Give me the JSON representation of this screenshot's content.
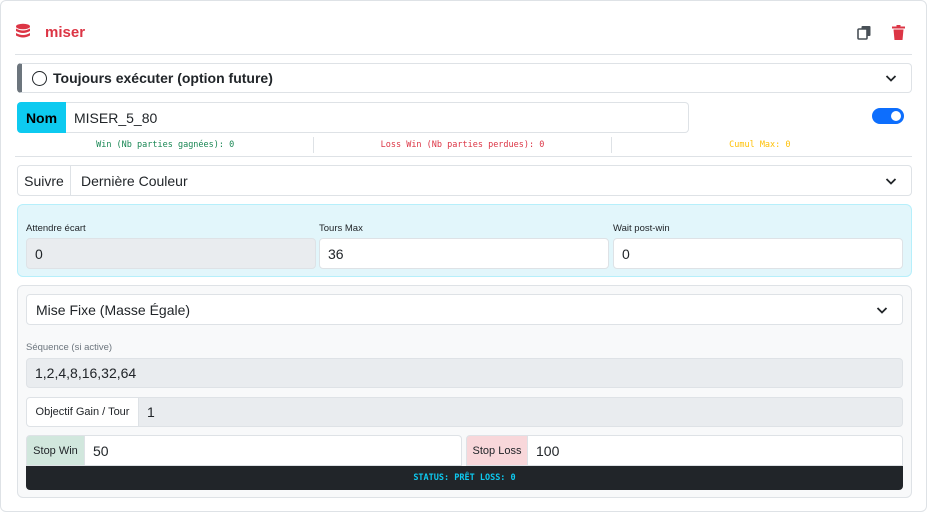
{
  "header": {
    "title": "miser",
    "title_icon": "database-icon",
    "actions": [
      "copy-icon",
      "trash-icon"
    ],
    "accent_color": "#dc3545"
  },
  "execute": {
    "label": "Toujours exécuter (option future)",
    "checked": false
  },
  "name": {
    "addon": "Nom",
    "value": "MISER_5_80",
    "enabled": true
  },
  "stats": {
    "win": "Win (Nb parties gagnées): 0",
    "loss": "Loss Win (Nb parties perdues): 0",
    "cumul": "Cumul Max: 0"
  },
  "follow": {
    "addon": "Suivre",
    "selected": "Dernière Couleur"
  },
  "params": {
    "wait_gap": {
      "label": "Attendre écart",
      "value": "0"
    },
    "max_turns": {
      "label": "Tours Max",
      "value": "36"
    },
    "wait_post_win": {
      "label": "Wait post-win",
      "value": "0"
    }
  },
  "mise": {
    "selected": "Mise Fixe (Masse Égale)",
    "sequence_label": "Séquence (si active)",
    "sequence_value": "1,2,4,8,16,32,64",
    "objective_label": "Objectif Gain / Tour",
    "objective_value": "1",
    "stop_win_label": "Stop Win",
    "stop_win_value": "50",
    "stop_loss_label": "Stop Loss",
    "stop_loss_value": "100",
    "status": "STATUS: PRÊT LOSS: 0"
  }
}
